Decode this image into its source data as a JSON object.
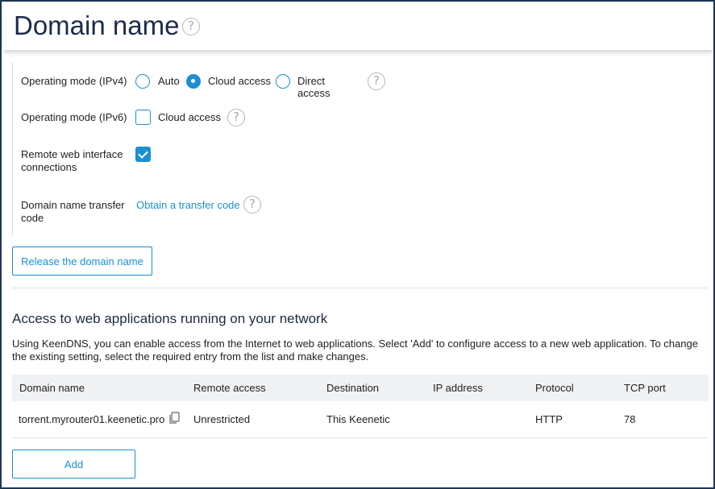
{
  "header": {
    "title": "Domain name"
  },
  "settings": {
    "ipv4": {
      "label": "Operating mode (IPv4)",
      "options": [
        "Auto",
        "Cloud access",
        "Direct access"
      ],
      "selected": "Cloud access"
    },
    "ipv6": {
      "label": "Operating mode (IPv6)",
      "option": "Cloud access",
      "checked": false
    },
    "remote_web": {
      "label_line1": "Remote web interface",
      "label_line2": "connections",
      "checked": true
    },
    "transfer": {
      "label_line1": "Domain name transfer",
      "label_line2": "code",
      "link": "Obtain a transfer code"
    },
    "release_button": "Release the domain name"
  },
  "apps": {
    "title": "Access to web applications running on your network",
    "description": "Using KeenDNS, you can enable access from the Internet to web applications. Select 'Add' to configure access to a new web application. To change the existing setting, select the required entry from the list and make changes.",
    "columns": [
      "Domain name",
      "Remote access",
      "Destination",
      "IP address",
      "Protocol",
      "TCP port"
    ],
    "rows": [
      {
        "domain": "torrent.myrouter01.keenetic.pro",
        "remote_access": "Unrestricted",
        "destination": "This Keenetic",
        "ip": "",
        "protocol": "HTTP",
        "port": "78"
      }
    ],
    "add_button": "Add"
  },
  "icons": {
    "help": "help-icon",
    "copy": "copy-icon"
  },
  "colors": {
    "accent": "#1a8fd1",
    "title": "#1d2b4a",
    "frame": "#1d3557"
  }
}
